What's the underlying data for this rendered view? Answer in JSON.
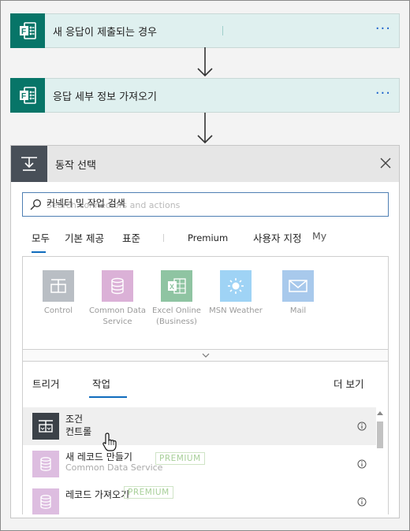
{
  "flow": {
    "trigger_title": "새 응답이 제출되는 경우",
    "step_title": "응답 세부 정보 가져오기",
    "more_glyph": "···"
  },
  "panel": {
    "title": "동작 선택",
    "close_icon": "close-icon",
    "search": {
      "value": "커넥터 및 작업 검색",
      "placeholder": "Search connectors and actions"
    },
    "tabs": [
      {
        "label": "모두",
        "active": true
      },
      {
        "label": "기본 제공",
        "active": false
      },
      {
        "label": "표준",
        "active": false
      },
      {
        "label": "Premium",
        "active": false
      },
      {
        "label": "사용자 지정",
        "active": false
      },
      {
        "label": "My",
        "active": false
      }
    ],
    "connectors": [
      {
        "label": "Control",
        "color": "#8b949e"
      },
      {
        "label": "Common Data Service",
        "color": "#b76ab1"
      },
      {
        "label": "Excel Online (Business)",
        "color": "#1e7145"
      },
      {
        "label": "MSN Weather",
        "color": "#3aa0e8"
      },
      {
        "label": "Mail",
        "color": "#4e93d8"
      }
    ],
    "subtabs": {
      "trigger": "트리거",
      "action": "작업",
      "more": "더 보기"
    },
    "actions": [
      {
        "name": "조건",
        "sub": "컨트롤",
        "badge": "",
        "color": "#3b4148"
      },
      {
        "name": "새 레코드 만들기",
        "sub": "Common Data Service",
        "badge": "PREMIUM",
        "color": "#c9a6cf"
      },
      {
        "name": "레코드 가져오기",
        "sub": "",
        "badge": "PREMIUM",
        "color": "#c9a6cf"
      }
    ]
  },
  "colors": {
    "accent": "#0f6cbd",
    "forms_teal": "#077568",
    "card_bg": "#dff0ef"
  }
}
